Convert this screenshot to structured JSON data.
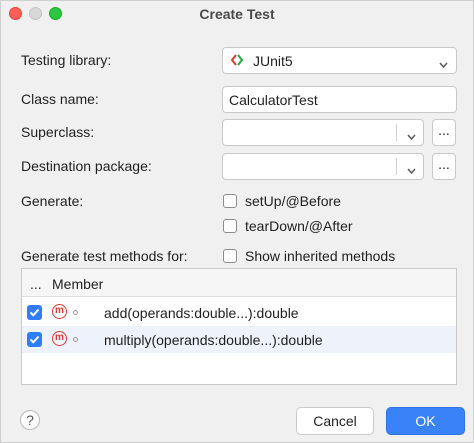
{
  "window": {
    "title": "Create Test"
  },
  "form": {
    "testing_library": {
      "label": "Testing library:",
      "value": "JUnit5",
      "icon": "junit-icon"
    },
    "class_name": {
      "label": "Class name:",
      "value": "CalculatorTest"
    },
    "superclass": {
      "label": "Superclass:",
      "value": "",
      "browse_label": "..."
    },
    "destination_package": {
      "label": "Destination package:",
      "value": "",
      "browse_label": "..."
    },
    "generate": {
      "label": "Generate:",
      "setup": {
        "label": "setUp/@Before",
        "checked": false
      },
      "teardown": {
        "label": "tearDown/@After",
        "checked": false
      }
    },
    "methods_for": {
      "label": "Generate test methods for:",
      "show_inherited": {
        "label": "Show inherited methods",
        "checked": false
      }
    }
  },
  "table": {
    "columns": [
      "...",
      "Member"
    ],
    "rows": [
      {
        "checked": true,
        "icon": "method-icon",
        "member": "add(operands:double...):double",
        "selected": false
      },
      {
        "checked": true,
        "icon": "method-icon",
        "member": "multiply(operands:double...):double",
        "selected": true
      }
    ]
  },
  "footer": {
    "help_label": "?",
    "cancel_label": "Cancel",
    "ok_label": "OK"
  },
  "colors": {
    "accent": "#3a82f7",
    "method_icon": "#d93b32"
  }
}
